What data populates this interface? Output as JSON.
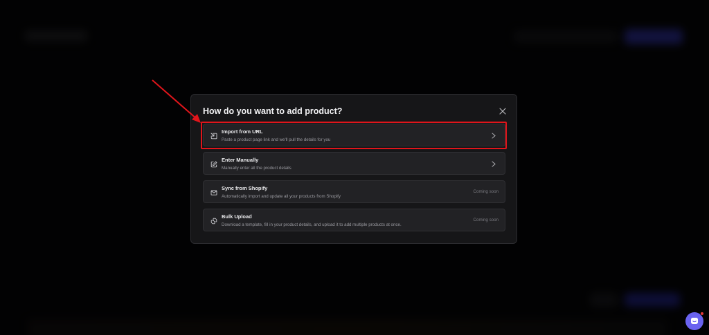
{
  "modal": {
    "title": "How do you want to add product?",
    "options": [
      {
        "title": "Import from URL",
        "description": "Paste a product page link and we'll pull the details for you",
        "icon": "import-icon",
        "status": ""
      },
      {
        "title": "Enter Manually",
        "description": "Manually enter all the product details",
        "icon": "edit-icon",
        "status": ""
      },
      {
        "title": "Sync from Shopify",
        "description": "Automatically import and update all your products from Shopify",
        "icon": "mail-icon",
        "status": "Coming soon"
      },
      {
        "title": "Bulk Upload",
        "description": "Download a template, fill in your product details, and upload it to add multiple products at once.",
        "icon": "boxes-icon",
        "status": "Coming soon"
      }
    ]
  },
  "annotation": {
    "highlight_color": "#e0151b",
    "highlighted_option": "Import from URL"
  },
  "colors": {
    "modal_bg": "#161618",
    "option_bg": "#222225",
    "chat_accent": "#6a63f0",
    "notification_dot": "#e43b3b"
  }
}
